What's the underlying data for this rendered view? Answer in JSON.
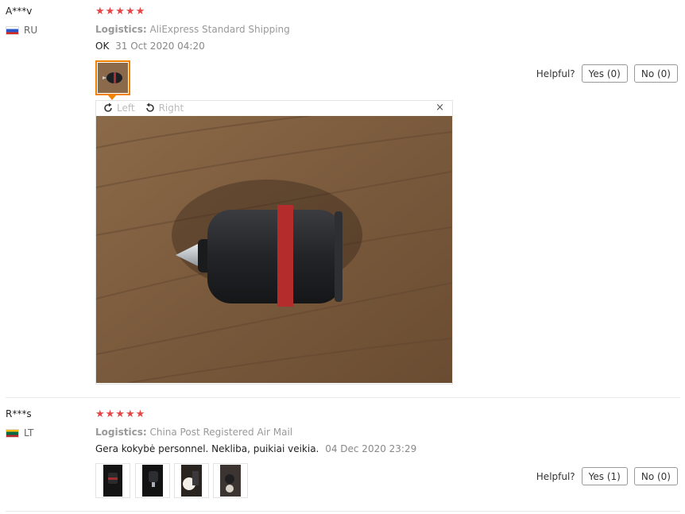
{
  "reviews": [
    {
      "user": "A***v",
      "country": "RU",
      "stars": "★★★★★",
      "logistics_label": "Logistics:",
      "logistics_value": "AliExpress Standard Shipping",
      "comment": "OK",
      "date": "31 Oct 2020 04:20",
      "helpful_label": "Helpful?",
      "yes": "Yes (0)",
      "no": "No (0)",
      "viewer": {
        "left": "Left",
        "right": "Right",
        "close": "×"
      }
    },
    {
      "user": "R***s",
      "country": "LT",
      "stars": "★★★★★",
      "logistics_label": "Logistics:",
      "logistics_value": "China Post Registered Air Mail",
      "comment": "Gera kokybė personnel. Nekliba, puikiai veikia.",
      "date": "04 Dec 2020 23:29",
      "helpful_label": "Helpful?",
      "yes": "Yes (1)",
      "no": "No (0)"
    }
  ],
  "colors": {
    "star": "#e64545",
    "accent": "#f08200"
  }
}
